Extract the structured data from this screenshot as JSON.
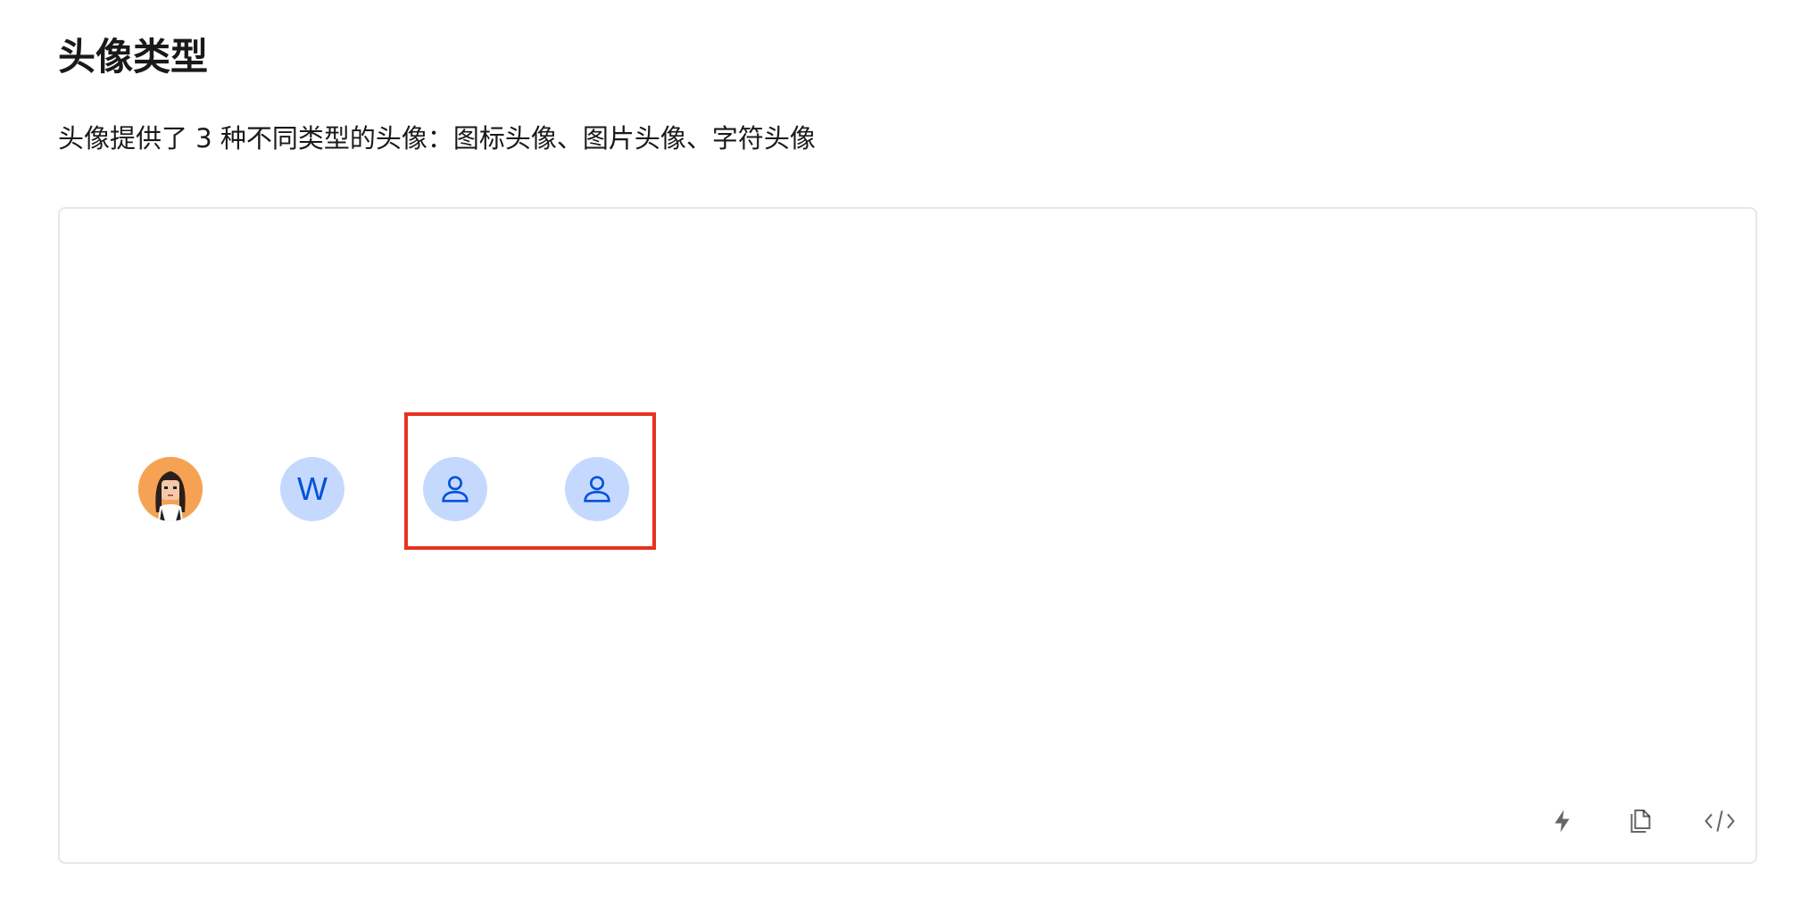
{
  "header": {
    "title": "头像类型",
    "description": "头像提供了 3 种不同类型的头像：图标头像、图片头像、字符头像"
  },
  "demo": {
    "avatars": [
      {
        "type": "image",
        "icon": "portrait-image"
      },
      {
        "type": "character",
        "char": "W"
      },
      {
        "type": "icon",
        "icon": "user-icon"
      },
      {
        "type": "icon",
        "icon": "user-icon"
      }
    ],
    "colors": {
      "avatar_bg": "#c5d9ff",
      "avatar_fg": "#0052d9",
      "image_bg": "#f6a254",
      "highlight": "#e8321f"
    }
  },
  "toolbar": {
    "items": [
      {
        "name": "lightning-icon"
      },
      {
        "name": "copy-icon"
      },
      {
        "name": "code-icon"
      }
    ]
  }
}
